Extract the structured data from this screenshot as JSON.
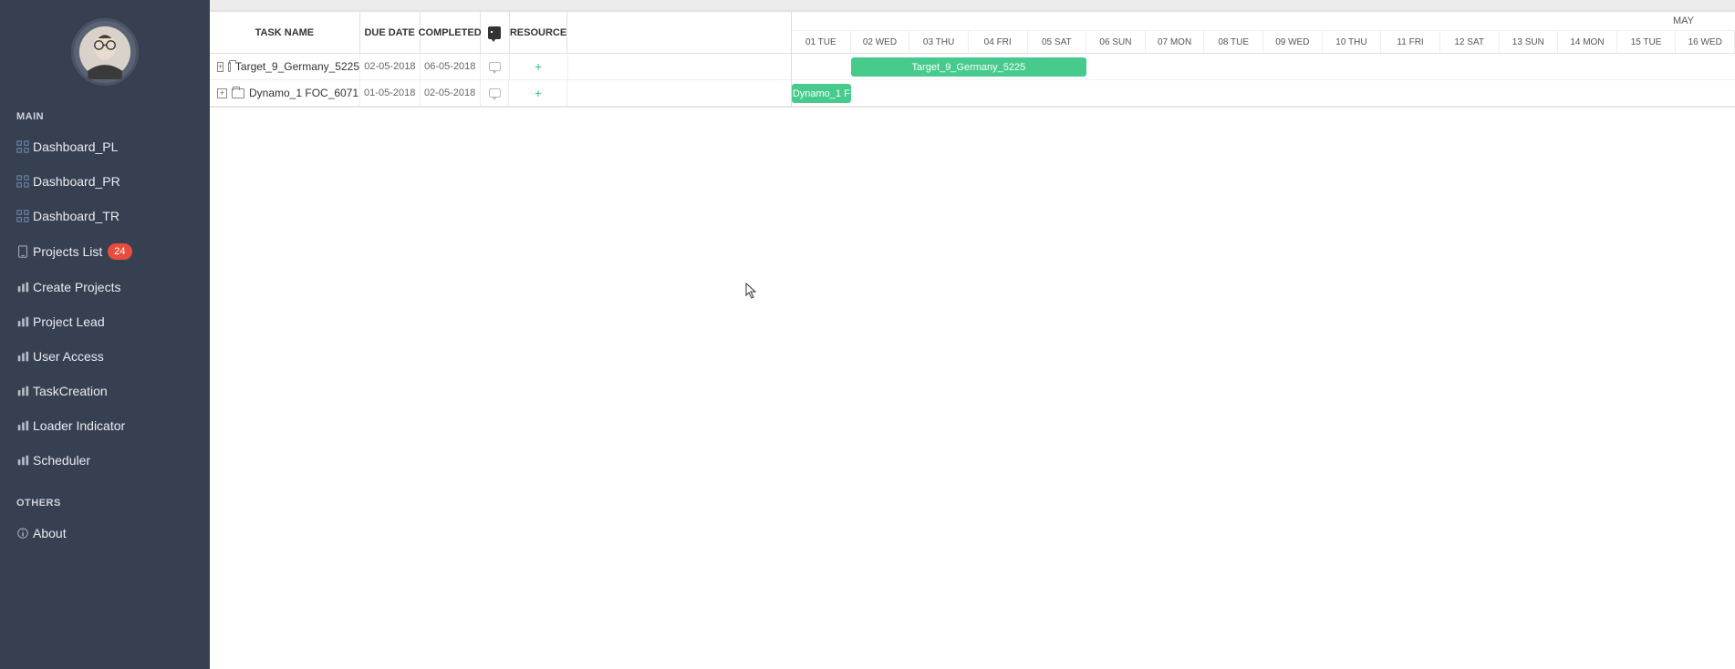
{
  "sidebar": {
    "section_main": "MAIN",
    "section_others": "OTHERS",
    "items": [
      {
        "label": "Dashboard_PL",
        "icon": "grid"
      },
      {
        "label": "Dashboard_PR",
        "icon": "grid"
      },
      {
        "label": "Dashboard_TR",
        "icon": "grid"
      },
      {
        "label": "Projects List",
        "icon": "device",
        "badge": "24"
      },
      {
        "label": "Create Projects",
        "icon": "bars"
      },
      {
        "label": "Project Lead",
        "icon": "bars"
      },
      {
        "label": "User Access",
        "icon": "bars"
      },
      {
        "label": "TaskCreation",
        "icon": "bars"
      },
      {
        "label": "Loader Indicator",
        "icon": "bars"
      },
      {
        "label": "Scheduler",
        "icon": "bars"
      }
    ],
    "others": [
      {
        "label": "About",
        "icon": "info"
      }
    ]
  },
  "grid": {
    "headers": {
      "taskname": "TASK NAME",
      "duedate": "DUE DATE",
      "completed": "COMPLETED",
      "resource": "RESOURCE"
    },
    "rows": [
      {
        "name": "Target_9_Germany_5225",
        "due": "02-05-2018",
        "completed": "06-05-2018"
      },
      {
        "name": "Dynamo_1 FOC_6071",
        "due": "01-05-2018",
        "completed": "02-05-2018"
      }
    ]
  },
  "timeline": {
    "month": "MAY",
    "days": [
      "01 TUE",
      "02 WED",
      "03 THU",
      "04 FRI",
      "05 SAT",
      "06 SUN",
      "07 MON",
      "08 TUE",
      "09 WED",
      "10 THU",
      "11 FRI",
      "12 SAT",
      "13 SUN",
      "14 MON",
      "15 TUE",
      "16 WED"
    ],
    "bars": [
      {
        "row": 0,
        "label": "Target_9_Germany_5225",
        "start_col": 1,
        "span": 4
      },
      {
        "row": 1,
        "label": "Dynamo_1 F",
        "start_col": 0,
        "span": 1
      }
    ]
  },
  "colors": {
    "sidebar_bg": "#374051",
    "accent_green": "#46cb8d",
    "badge_red": "#e74c3c"
  }
}
